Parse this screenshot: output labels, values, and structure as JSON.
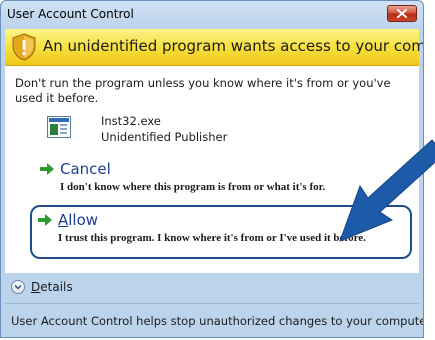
{
  "window": {
    "title": "User Account Control",
    "close_icon": "close-x-icon"
  },
  "header": {
    "icon": "shield-warning-icon",
    "text": "An unidentified program wants access to your computer"
  },
  "warning": {
    "text": "Don't run the program unless you know where it's from or you've used it before."
  },
  "program": {
    "icon": "program-file-icon",
    "file_name": "Inst32.exe",
    "publisher": "Unidentified Publisher"
  },
  "options": {
    "cancel": {
      "label": "Cancel",
      "description": "I don't know where this program is from or what it's for."
    },
    "allow": {
      "label": "Allow",
      "description": "I trust this program. I know where it's from or I've used it before."
    }
  },
  "details": {
    "label": "Details"
  },
  "footer": {
    "text": "User Account Control helps stop unauthorized changes to your computer."
  },
  "colors": {
    "header_yellow": "#f6de3a",
    "link_blue": "#1c3f94",
    "highlight_border": "#1f4e8c",
    "arrow_green": "#2e9a2e",
    "pointer_arrow": "#1d5aa8"
  }
}
